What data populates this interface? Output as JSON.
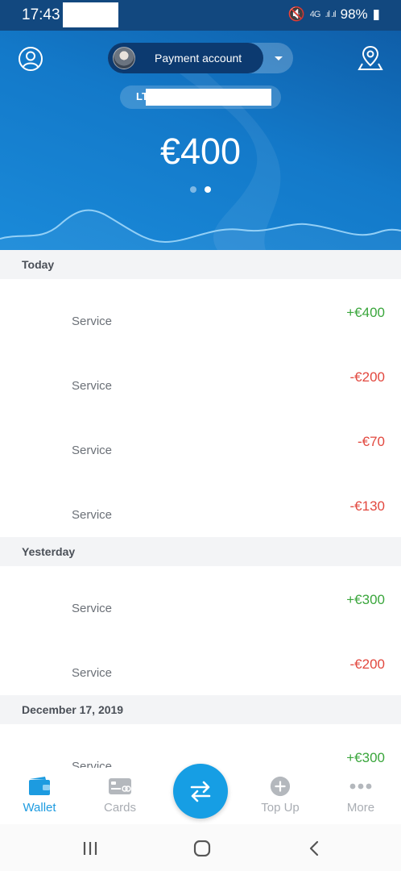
{
  "status_bar": {
    "time": "17:43",
    "network": "4G",
    "battery": "98%"
  },
  "header": {
    "account_label": "Payment account",
    "iban_prefix": "LT",
    "balance": "€400",
    "page_count": 2,
    "active_page": 2
  },
  "transactions": [
    {
      "section": "Today",
      "items": [
        {
          "name": "Service",
          "amount": "+€400",
          "type": "positive"
        },
        {
          "name": "Service",
          "amount": "-€200",
          "type": "negative"
        },
        {
          "name": "Service",
          "amount": "-€70",
          "type": "negative"
        },
        {
          "name": "Service",
          "amount": "-€130",
          "type": "negative"
        }
      ]
    },
    {
      "section": "Yesterday",
      "items": [
        {
          "name": "Service",
          "amount": "+€300",
          "type": "positive"
        },
        {
          "name": "Service",
          "amount": "-€200",
          "type": "negative"
        }
      ]
    },
    {
      "section": "December 17, 2019",
      "items": [
        {
          "name": "Service",
          "amount": "+€300",
          "type": "positive"
        }
      ]
    }
  ],
  "bottom_nav": {
    "wallet": "Wallet",
    "cards": "Cards",
    "top_up": "Top Up",
    "more": "More",
    "active": "wallet"
  },
  "colors": {
    "accent": "#169ee4",
    "positive": "#3aa63c",
    "negative": "#e2483f",
    "header": "#1379c9"
  }
}
